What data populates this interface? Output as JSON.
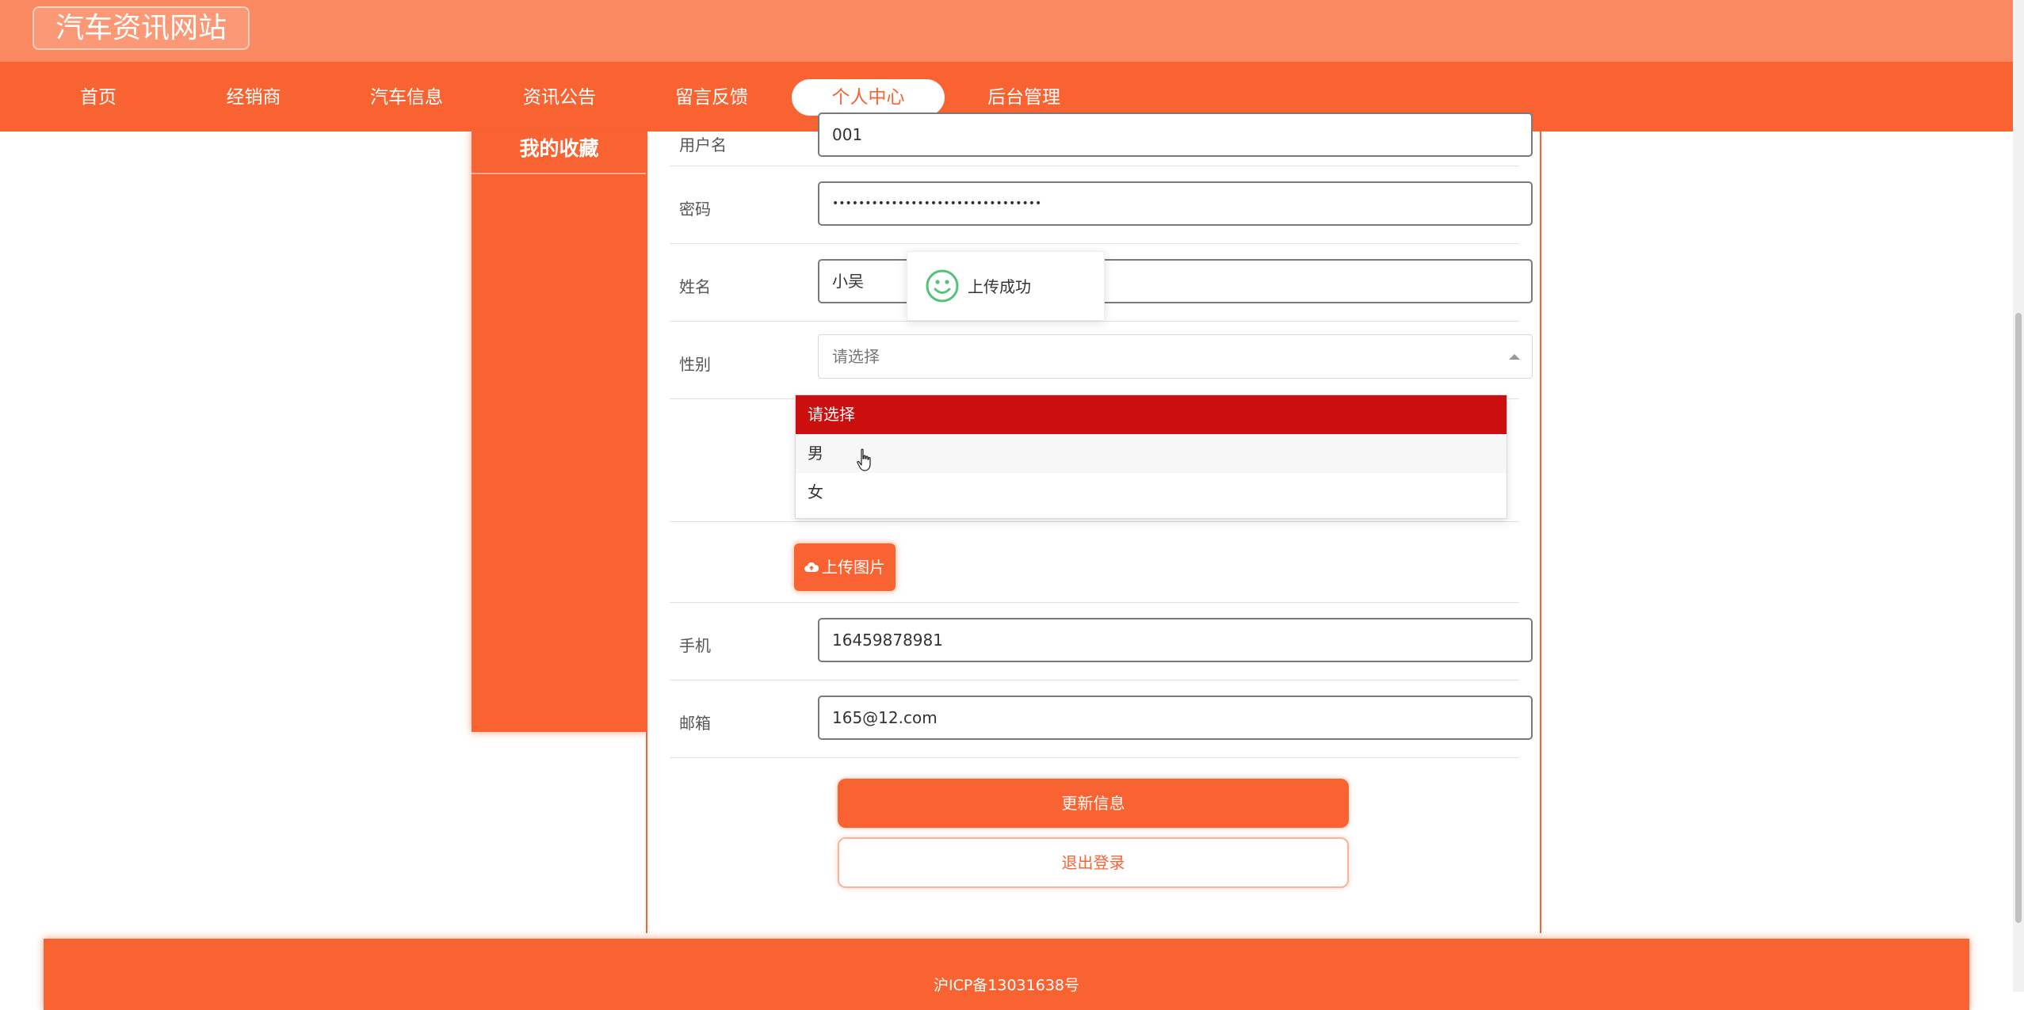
{
  "site": {
    "title": "汽车资讯网站"
  },
  "nav": {
    "items": [
      "首页",
      "经销商",
      "汽车信息",
      "资讯公告",
      "留言反馈",
      "个人中心",
      "后台管理"
    ],
    "active": "个人中心"
  },
  "sidebar": {
    "title": "我的收藏"
  },
  "form": {
    "username": {
      "label": "用户名",
      "value": "001"
    },
    "password": {
      "label": "密码",
      "value": "••••••••••••••••••••••••••••••••"
    },
    "name": {
      "label": "姓名",
      "value": "小吴"
    },
    "gender": {
      "label": "性别",
      "placeholder": "请选择",
      "options": [
        "请选择",
        "男",
        "女"
      ],
      "selected": "请选择",
      "hovered": "男"
    },
    "avatar": {
      "upload_label": "上传图片"
    },
    "phone": {
      "label": "手机",
      "value": "16459878981"
    },
    "email": {
      "label": "邮箱",
      "value": "165@12.com"
    }
  },
  "actions": {
    "update": "更新信息",
    "logout": "退出登录"
  },
  "toast": {
    "message": "上传成功",
    "icon": "smile-icon",
    "color": "#52c47a"
  },
  "footer": {
    "icp": "沪ICP备13031638号"
  },
  "colors": {
    "primary": "#f96332",
    "header": "#fb8a62",
    "selected_option": "#cb0e0e"
  }
}
